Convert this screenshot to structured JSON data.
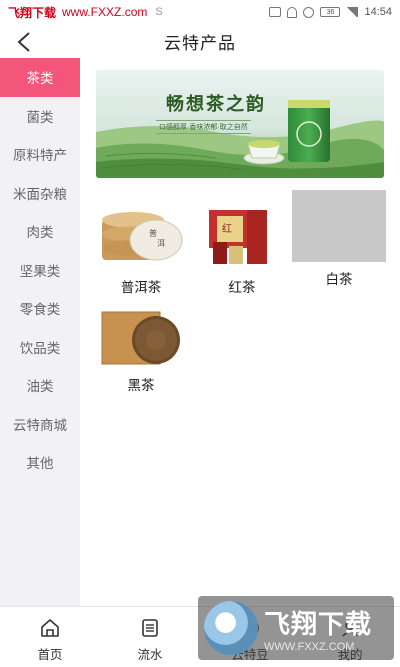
{
  "status_bar": {
    "watermark_name": "飞翔下载",
    "watermark_url": "www.FXXZ.com",
    "signal_text": "S",
    "battery": "36",
    "time": "14:54"
  },
  "header": {
    "title": "云特产品"
  },
  "sidebar": {
    "active_index": 0,
    "items": [
      {
        "label": "茶类"
      },
      {
        "label": "菌类"
      },
      {
        "label": "原料特产"
      },
      {
        "label": "米面杂粮"
      },
      {
        "label": "肉类"
      },
      {
        "label": "坚果类"
      },
      {
        "label": "零食类"
      },
      {
        "label": "饮品类"
      },
      {
        "label": "油类"
      },
      {
        "label": "云特商城"
      },
      {
        "label": "其他"
      }
    ]
  },
  "banner": {
    "brand_text": "畅想茶之韵",
    "tagline": "口感醇厚·香味浓郁·取之自然"
  },
  "products": [
    {
      "name": "普洱茶"
    },
    {
      "name": "红茶"
    },
    {
      "name": "白茶"
    },
    {
      "name": "黑茶"
    }
  ],
  "tabbar": {
    "tabs": [
      {
        "label": "首页",
        "icon": "home-icon"
      },
      {
        "label": "流水",
        "icon": "list-icon"
      },
      {
        "label": "云特豆",
        "icon": "bean-icon"
      },
      {
        "label": "我的",
        "icon": "user-icon"
      }
    ]
  },
  "watermark": {
    "big": "飞翔下载",
    "small": "WWW.FXXZ.COM"
  },
  "colors": {
    "accent": "#f4557a",
    "sidebar_bg": "#f2f2f4"
  }
}
